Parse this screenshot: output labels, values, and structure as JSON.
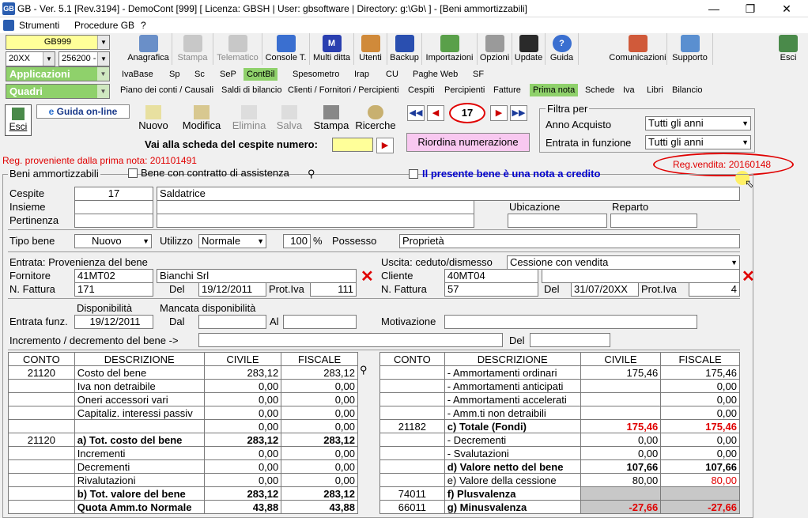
{
  "window": {
    "title": "GB - Ver. 5.1 [Rev.3194] - DemoCont [999]    [ Licenza: GBSH | User: gbsoftware | Directory: g:\\Gb\\ ] - [Beni ammortizzabili]",
    "app_icon": "GB"
  },
  "menu": {
    "items": [
      "Strumenti",
      "Procedure GB",
      "?"
    ]
  },
  "selectors": {
    "company": "GB999",
    "year": "20XX",
    "code": "256200 -",
    "applicazioni": "Applicazioni",
    "quadri": "Quadri"
  },
  "toolbar": {
    "buttons": [
      "Anagrafica",
      "Stampa",
      "Telematico",
      "Console T.",
      "Multi ditta",
      "Utenti",
      "Backup",
      "Importazioni",
      "Opzioni",
      "Update",
      "Guida",
      "Comunicazioni",
      "Supporto",
      "Esci"
    ]
  },
  "tabs1": [
    "IvaBase",
    "Sp",
    "Sc",
    "SeP",
    "ContBil",
    "Spesometro",
    "Irap",
    "CU",
    "Paghe Web",
    "SF"
  ],
  "tabs2": [
    "Piano dei conti / Causali",
    "Saldi di bilancio",
    "Clienti / Fornitori / Percipienti",
    "Cespiti",
    "Percipienti",
    "Fatture",
    "Prima nota",
    "Schede",
    "Iva",
    "Libri",
    "Bilancio"
  ],
  "form": {
    "esci": "Esci",
    "guida_online": "Guida on-line",
    "actions": [
      "Nuovo",
      "Modifica",
      "Elimina",
      "Salva",
      "Stampa",
      "Ricerche"
    ],
    "record_number": "17",
    "vai_label": "Vai alla scheda del cespite numero:",
    "riordina": "Riordina numerazione",
    "filtra_per": "Filtra per",
    "anno_acquisto_label": "Anno Acquisto",
    "anno_acquisto_value": "Tutti gli anni",
    "entrata_funzione_label": "Entrata in funzione",
    "entrata_funzione_value": "Tutti gli anni",
    "reg_prov": "Reg. proveniente dalla prima nota: 201101491",
    "reg_vendita": "Reg.vendita: 20160148",
    "group_title": "Beni ammortizzabili",
    "contratto": "Bene con contratto di assistenza",
    "nota_credito": "Il presente bene è una nota a credito",
    "cespite_label": "Cespite",
    "cespite_num": "17",
    "cespite_desc": "Saldatrice",
    "insieme_label": "Insieme",
    "pertinenza_label": "Pertinenza",
    "ubicazione_label": "Ubicazione",
    "reparto_label": "Reparto",
    "tipo_bene_label": "Tipo bene",
    "tipo_bene": "Nuovo",
    "utilizzo_label": "Utilizzo",
    "utilizzo": "Normale",
    "perc": "100",
    "perc_sign": "%",
    "possesso_label": "Possesso",
    "possesso": "Proprietà",
    "entrata_label": "Entrata: Provenienza del bene",
    "fornitore_label": "Fornitore",
    "fornitore_code": "41MT02",
    "fornitore_name": "Bianchi Srl",
    "nfattura_label": "N. Fattura",
    "nfattura": "171",
    "del_label": "Del",
    "del_value": "19/12/2011",
    "protiva_label": "Prot.Iva",
    "protiva": "111",
    "uscita_label": "Uscita: ceduto/dismesso",
    "uscita_value": "Cessione con vendita",
    "cliente_label": "Cliente",
    "cliente_code": "40MT04",
    "nfattura2": "57",
    "del2": "31/07/20XX",
    "protiva2": "4",
    "disponibilita_label": "Disponibilità",
    "mancata_label": "Mancata disponibilità",
    "entrata_funz_label": "Entrata funz.",
    "entrata_funz": "19/12/2011",
    "dal_label": "Dal",
    "al_label": "Al",
    "motivazione_label": "Motivazione",
    "incremento_label": "Incremento / decremento del bene ->"
  },
  "left_table": {
    "headers": [
      "CONTO",
      "DESCRIZIONE",
      "CIVILE",
      "FISCALE"
    ],
    "rows": [
      [
        "21120",
        "Costo del bene",
        "283,12",
        "283,12"
      ],
      [
        "",
        "Iva non detraibile",
        "0,00",
        "0,00"
      ],
      [
        "",
        "Oneri accessori vari",
        "0,00",
        "0,00"
      ],
      [
        "",
        "Capitaliz. interessi passiv",
        "0,00",
        "0,00"
      ],
      [
        "",
        "",
        "0,00",
        "0,00"
      ],
      [
        "21120",
        "a) Tot. costo del bene",
        "283,12",
        "283,12"
      ],
      [
        "",
        "Incrementi",
        "0,00",
        "0,00"
      ],
      [
        "",
        "Decrementi",
        "0,00",
        "0,00"
      ],
      [
        "",
        "Rivalutazioni",
        "0,00",
        "0,00"
      ],
      [
        "",
        "b) Tot. valore del bene",
        "283,12",
        "283,12"
      ],
      [
        "",
        "Quota Amm.to Normale",
        "43,88",
        "43,88"
      ]
    ]
  },
  "right_table": {
    "headers": [
      "CONTO",
      "DESCRIZIONE",
      "CIVILE",
      "FISCALE"
    ],
    "rows": [
      [
        "",
        "- Ammortamenti ordinari",
        "175,46",
        "175,46"
      ],
      [
        "",
        "- Ammortamenti anticipati",
        "",
        "0,00"
      ],
      [
        "",
        "- Ammortamenti accelerati",
        "",
        "0,00"
      ],
      [
        "",
        "- Amm.ti non detraibili",
        "",
        "0,00"
      ],
      [
        "21182",
        "c) Totale (Fondi)",
        "175,46",
        "175,46"
      ],
      [
        "",
        "- Decrementi",
        "0,00",
        "0,00"
      ],
      [
        "",
        "- Svalutazioni",
        "0,00",
        "0,00"
      ],
      [
        "",
        "d) Valore netto del bene",
        "107,66",
        "107,66"
      ],
      [
        "",
        "e) Valore della cessione",
        "80,00",
        "80,00"
      ],
      [
        "74011",
        "f) Plusvalenza",
        "",
        ""
      ],
      [
        "66011",
        "g) Minusvalenza",
        "-27,66",
        "-27,66"
      ]
    ]
  },
  "colors": {
    "green": "#8fd16b",
    "red": "#e00000",
    "blue": "#0000cc"
  }
}
